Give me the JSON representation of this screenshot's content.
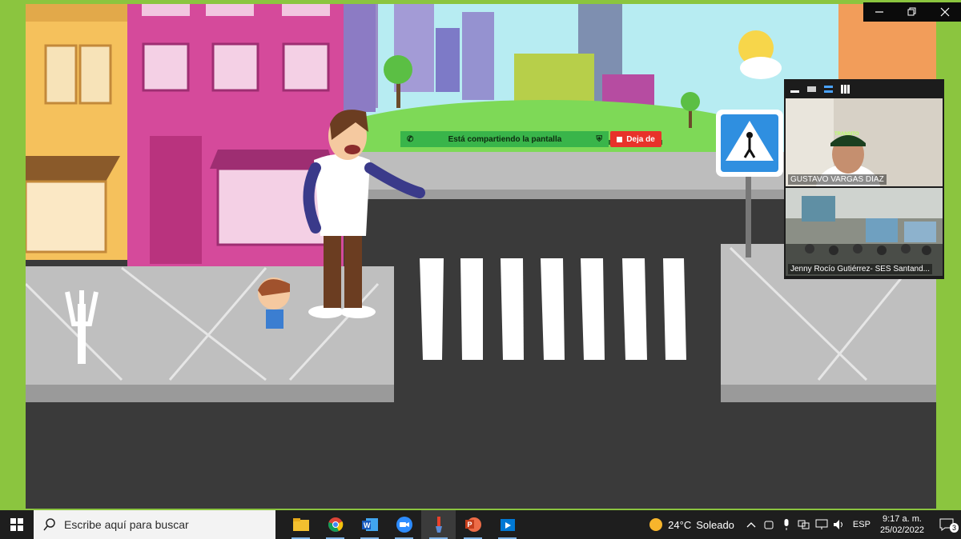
{
  "window": {
    "controls": [
      "minimize",
      "restore",
      "close"
    ]
  },
  "share_banner": {
    "text": "Está compartiendo la pantalla",
    "stop_label": "Deja de"
  },
  "participants": [
    {
      "name": "GUSTAVO VARGAS DIAZ",
      "cap_text": "TRANSITO"
    },
    {
      "name": "Jenny Rocío Gutiérrez- SES Santand..."
    }
  ],
  "taskbar": {
    "search_placeholder": "Escribe aquí para buscar",
    "apps": [
      "file-explorer",
      "chrome",
      "word",
      "zoom",
      "paint",
      "powerpoint",
      "photos"
    ],
    "weather": {
      "temp": "24°C",
      "condition": "Soleado"
    },
    "language": "ESP",
    "time": "9:17 a. m.",
    "date": "25/02/2022",
    "notifications": "3"
  }
}
